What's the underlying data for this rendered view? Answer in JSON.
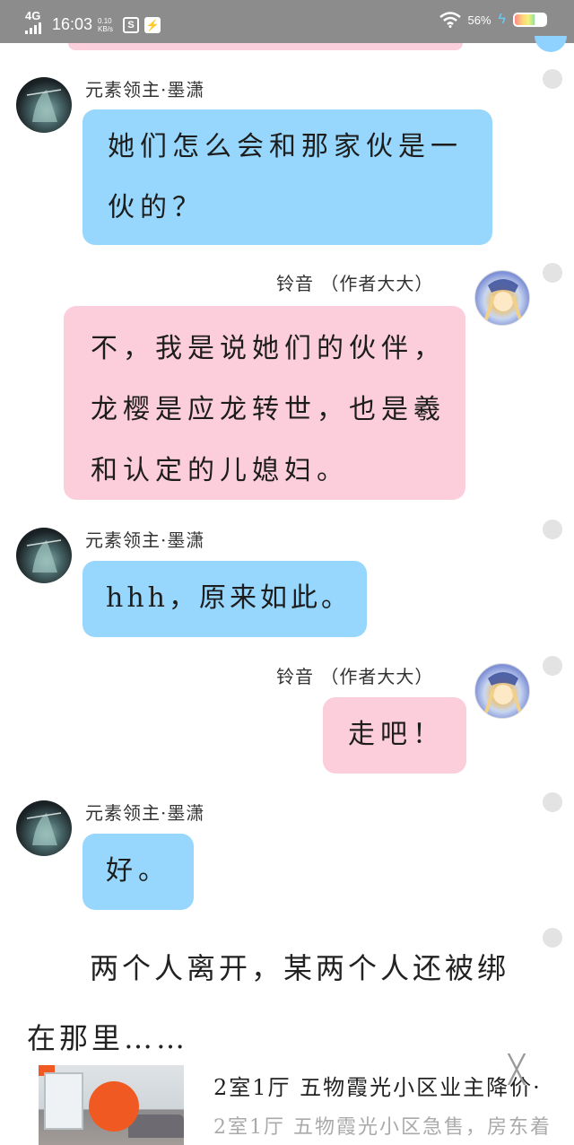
{
  "status_bar": {
    "network": "4G",
    "time": "16:03",
    "speed": "0.10 KB/s",
    "icon_1": "S",
    "icon_2": "⚡",
    "battery_percent": "56%"
  },
  "chat": {
    "character_a": "元素领主·墨潇",
    "character_b": "铃音 （作者大大）",
    "messages": [
      {
        "speaker": "元素领主·墨潇",
        "line1": "她们怎么会和那家伙是一",
        "line2": "伙的？"
      },
      {
        "speaker": "铃音 （作者大大）",
        "line1": "不，我是说她们的伙伴，",
        "line2": "龙樱是应龙转世，也是羲",
        "line3": "和认定的儿媳妇。"
      },
      {
        "speaker": "元素领主·墨潇",
        "line1": "hhh，原来如此。"
      },
      {
        "speaker": "铃音 （作者大大）",
        "line1": "走吧！"
      },
      {
        "speaker": "元素领主·墨潇",
        "line1": "好。"
      }
    ]
  },
  "narration": {
    "line1": "两个人离开，某两个人还被绑",
    "line2": "在那里……"
  },
  "ad": {
    "title": "2室1厅 五物霞光小区业主降价·",
    "subtitle": "2室1厅 五物霞光小区急售，房东着",
    "close_symbol": "╳"
  },
  "colors": {
    "blue_bubble": "#97d7fd",
    "pink_bubble": "#fccdda",
    "status_bar": "#8c8c8c"
  }
}
